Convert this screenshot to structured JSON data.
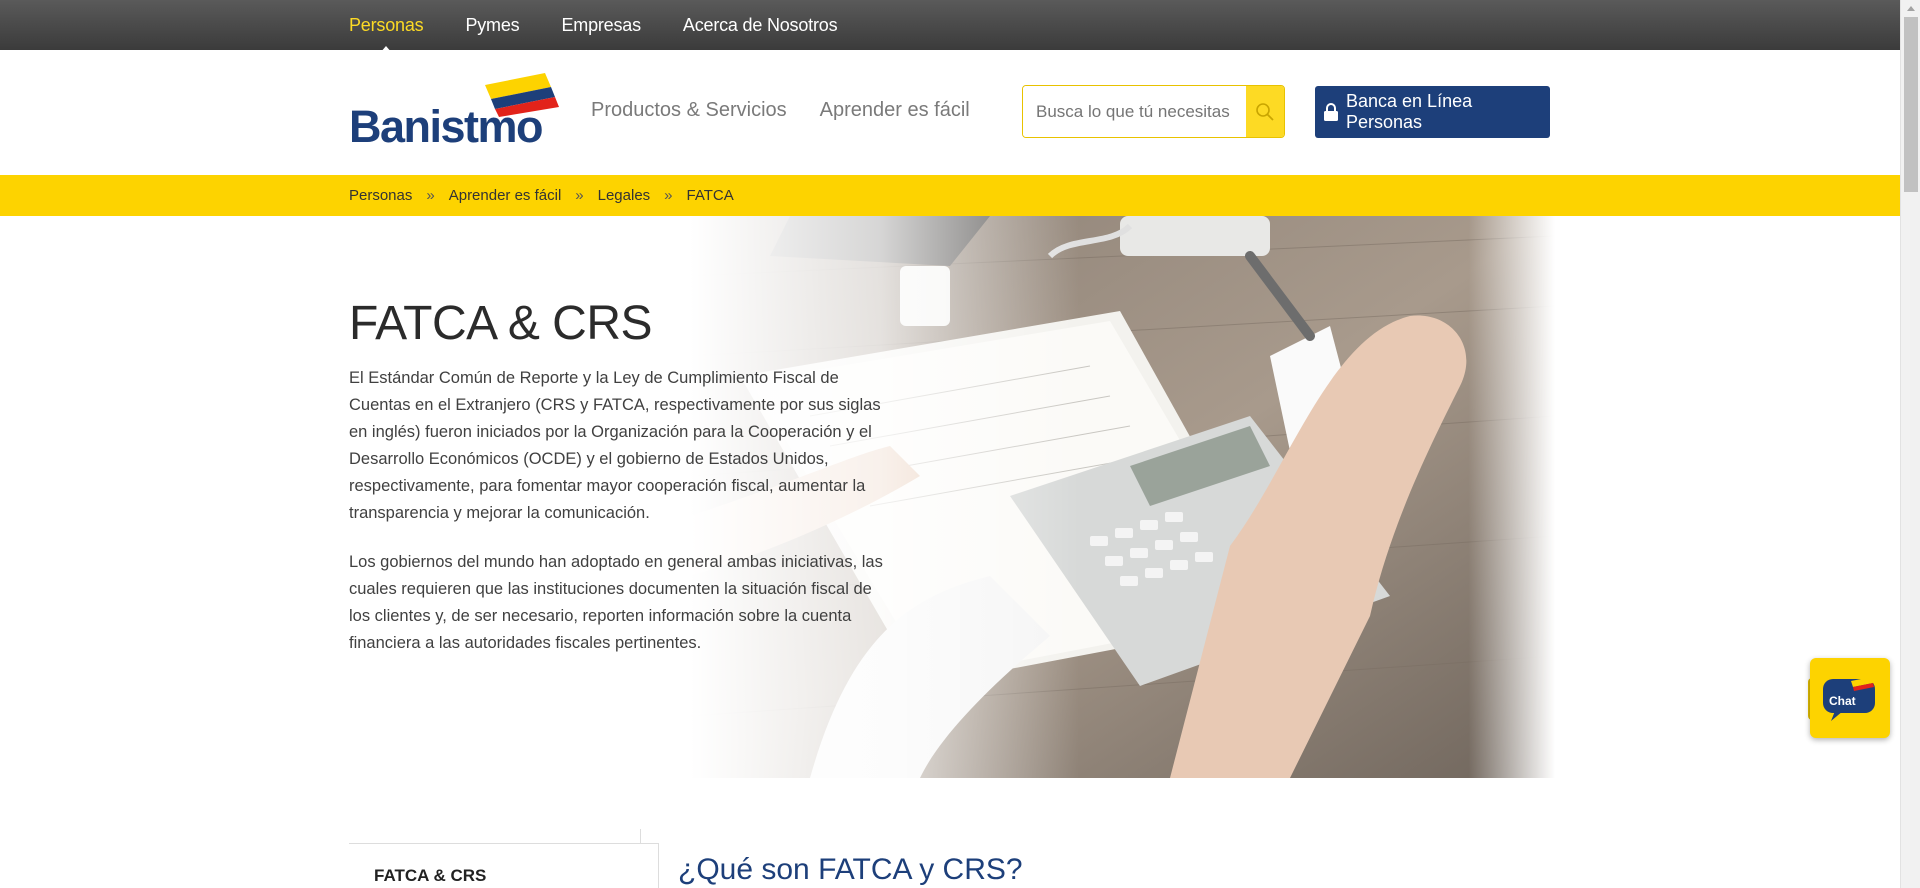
{
  "topnav": {
    "items": [
      {
        "label": "Personas",
        "active": true
      },
      {
        "label": "Pymes",
        "active": false
      },
      {
        "label": "Empresas",
        "active": false
      },
      {
        "label": "Acerca de Nosotros",
        "active": false
      }
    ]
  },
  "header": {
    "logo_text": "Banistmo",
    "nav": [
      {
        "label": "Productos & Servicios"
      },
      {
        "label": "Aprender es fácil"
      }
    ],
    "search": {
      "placeholder": "Busca lo que tú necesitas",
      "icon": "search-icon"
    },
    "cta_label": "Banca en Línea Personas",
    "cta_icon": "lock-icon"
  },
  "breadcrumb": {
    "items": [
      "Personas",
      "Aprender es fácil",
      "Legales",
      "FATCA"
    ],
    "separator": "»"
  },
  "hero": {
    "title": "FATCA & CRS",
    "paragraphs": [
      "El Estándar Común de Reporte y la Ley de Cumplimiento Fiscal de Cuentas en el Extranjero (CRS y FATCA, respectivamente por sus siglas en inglés) fueron iniciados por la Organización para la Cooperación y el Desarrollo Económicos (OCDE) y el gobierno de Estados Unidos, respectivamente, para fomentar mayor cooperación fiscal, aumentar la transparencia y mejorar la comunicación.",
      "Los gobiernos del mundo han adoptado en general ambas iniciativas, las cuales requieren que las instituciones documenten la situación fiscal de los clientes y, de ser necesario, reporten información sobre la cuenta financiera a las autoridades fiscales pertinentes."
    ]
  },
  "chat": {
    "label": "Chat"
  },
  "lower": {
    "sidemenu_item": "FATCA & CRS",
    "section_title": "¿Qué son FATCA y CRS?"
  },
  "colors": {
    "brand_blue": "#1d3f7a",
    "brand_yellow": "#fdd300",
    "topbar": "#3b3b3b"
  }
}
